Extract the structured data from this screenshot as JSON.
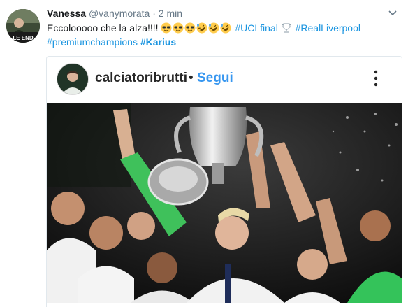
{
  "tweet": {
    "display_name": "Vanessa",
    "handle": "@vanymorata",
    "separator": "·",
    "time": "2 min",
    "text_before": "Eccolooooo che la alza!!!!",
    "hashtags": [
      "#UCLfinal",
      "#RealLiverpool",
      "#premiumchampions"
    ],
    "bold_hashtag": "#Karius",
    "emojis": [
      "smiling-face-with-sunglasses",
      "smiling-face-with-sunglasses",
      "smiling-face-with-sunglasses",
      "rolling-on-floor-laughing",
      "rolling-on-floor-laughing",
      "rolling-on-floor-laughing",
      "trophy"
    ],
    "avatar_caption": "LE END"
  },
  "embed": {
    "username": "calciatoribrutti",
    "separator": "•",
    "follow_label": "Segui"
  },
  "colors": {
    "link": "#1b95e0",
    "instagram_follow": "#3897f0",
    "muted": "#657786"
  }
}
